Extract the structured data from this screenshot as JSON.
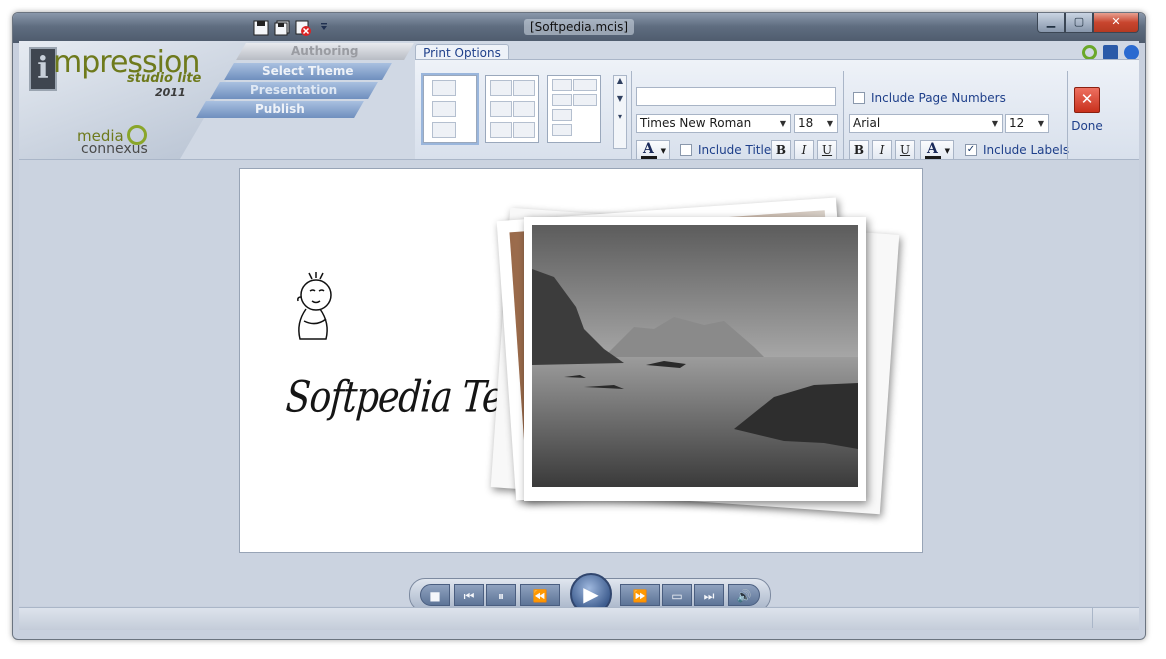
{
  "window": {
    "title": "[Softpedia.mcis]"
  },
  "window_controls": {
    "minimize": "▁",
    "maximize": "▢",
    "close": "✕"
  },
  "brand": {
    "word": "mpression",
    "initial": "i",
    "product": "studio lite",
    "year": "2011",
    "maker_line1": "media",
    "maker_line2": "connexus"
  },
  "nav": {
    "authoring": "Authoring",
    "select_theme": "Select Theme",
    "presentation": "Presentation",
    "publish": "Publish"
  },
  "ribbon": {
    "active_tab": "Print Options",
    "title_font": "Times New Roman",
    "title_size": "18",
    "include_title_label": "Include Title",
    "include_title_checked": false,
    "label_font": "Arial",
    "label_size": "12",
    "include_labels_label": "Include Labels",
    "include_labels_checked": true,
    "include_page_numbers_label": "Include Page Numbers",
    "include_page_numbers_checked": false,
    "title_text_value": "",
    "bold": "B",
    "italic": "I",
    "underline": "U",
    "font_color_glyph": "A",
    "done_label": "Done",
    "done_glyph": "✕"
  },
  "slide": {
    "caption": "Softpedia Test"
  },
  "player": {
    "stop": "■",
    "prev": "⏮",
    "pause": "⏸",
    "rewind": "⏪",
    "play": "▶",
    "forward": "⏩",
    "frame": "▭",
    "next": "⏭",
    "volume": "🔊"
  },
  "colors": {
    "accent": "#1e3f8a",
    "brand_green": "#6e7a1c",
    "close_red": "#c8452e"
  }
}
